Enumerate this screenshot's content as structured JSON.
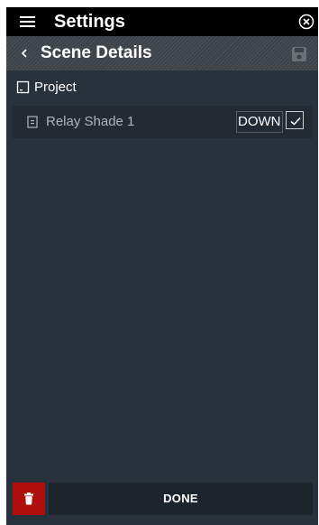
{
  "header": {
    "title": "Settings",
    "menu_icon": "hamburger-menu-icon",
    "close_icon": "close-circle-icon"
  },
  "subheader": {
    "title": "Scene Details",
    "back_icon": "chevron-left-icon",
    "save_icon": "save-icon"
  },
  "project": {
    "label": "Project",
    "icon": "project-icon"
  },
  "devices": [
    {
      "label": "Relay Shade 1",
      "state": "DOWN",
      "checked": true,
      "icon": "shade-icon"
    }
  ],
  "footer": {
    "done_label": "DONE",
    "delete_icon": "trash-icon"
  },
  "colors": {
    "topbar": "#000000",
    "background": "#28323c",
    "delete_red": "#b00d0d"
  }
}
